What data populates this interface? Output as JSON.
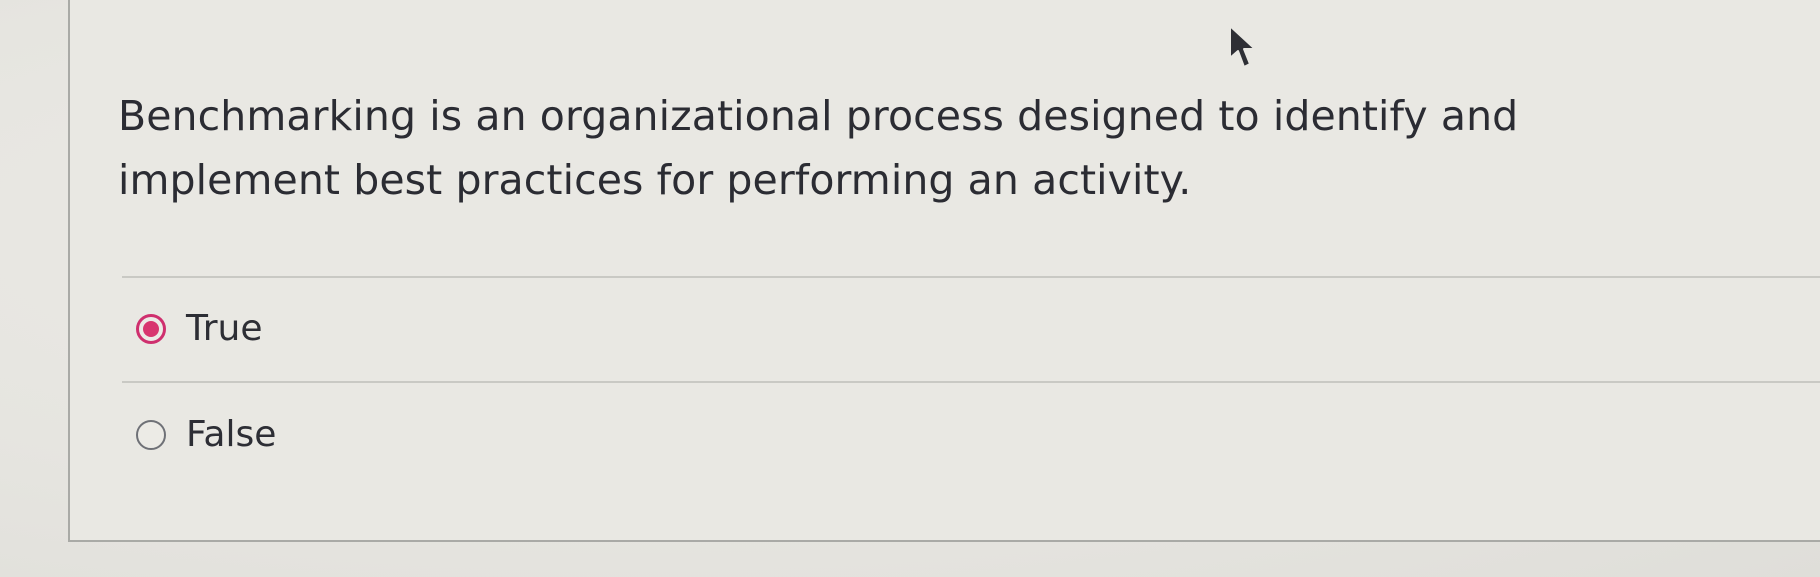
{
  "question": {
    "text": "Benchmarking is an organizational process designed to identify and implement best practices for performing an activity."
  },
  "answers": [
    {
      "label": "True",
      "selected": true
    },
    {
      "label": "False",
      "selected": false
    }
  ],
  "colors": {
    "selected_radio": "#d8366f",
    "text": "#2b2c33",
    "background": "#e6e5e0"
  },
  "icons": {
    "cursor": "mouse-pointer-icon"
  }
}
